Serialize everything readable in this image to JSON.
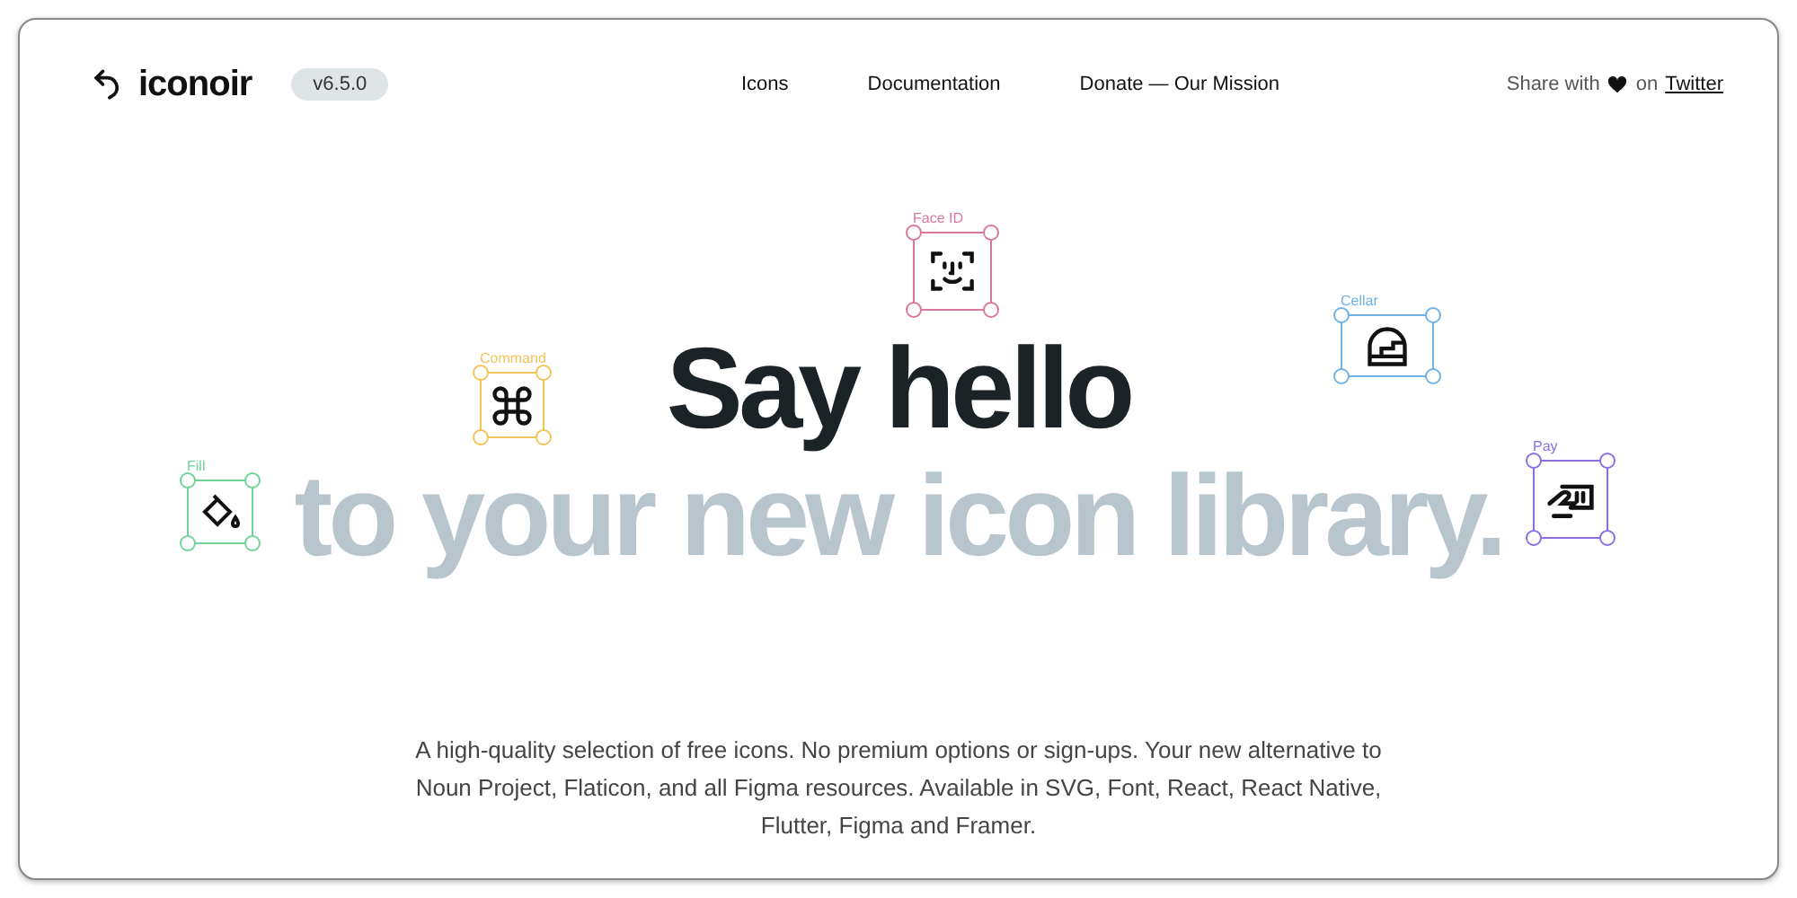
{
  "brand": {
    "name": "iconoir",
    "version": "v6.5.0"
  },
  "nav": [
    {
      "label": "Icons"
    },
    {
      "label": "Documentation"
    },
    {
      "label": "Donate — Our Mission"
    }
  ],
  "share": {
    "prefix": "Share with",
    "suffix": "on",
    "link": "Twitter"
  },
  "hero": {
    "line1": "Say hello",
    "line2": "to your new icon library."
  },
  "description": "A high-quality selection of free icons. No premium options or sign-ups. Your new alternative to Noun Project, Flaticon, and all Figma resources. Available in SVG, Font, React, React Native, Flutter, Figma and Framer.",
  "floating_icons": [
    {
      "label": "Face ID",
      "kind": "face",
      "color": "#d9779e"
    },
    {
      "label": "Command",
      "kind": "command",
      "color": "#f2c45a"
    },
    {
      "label": "Cellar",
      "kind": "cellar",
      "color": "#6fb2e6"
    },
    {
      "label": "Fill",
      "kind": "fill",
      "color": "#6fd39a"
    },
    {
      "label": "Pay",
      "kind": "pay",
      "color": "#8b6fe0"
    }
  ]
}
